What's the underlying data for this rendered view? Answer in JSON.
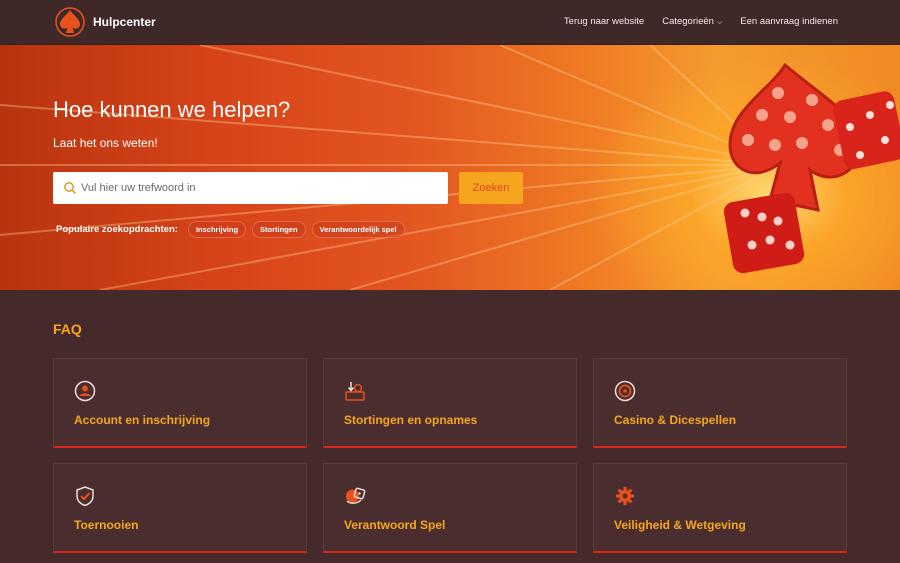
{
  "header": {
    "brand": "Hulpcenter",
    "nav": [
      {
        "label": "Terug naar website"
      },
      {
        "label": "Categorieën"
      },
      {
        "label": "Een aanvraag indienen"
      }
    ]
  },
  "hero": {
    "title": "Hoe kunnen we helpen?",
    "subtitle": "Laat het ons weten!",
    "search": {
      "placeholder": "Vul hier uw trefwoord in",
      "value": "",
      "button_label": "Zoeken"
    },
    "popular_label": "Populaire zoekopdrachten:",
    "popular": [
      "Inschrijving",
      "Stortingen",
      "Verantwoordelijk spel"
    ]
  },
  "faq": {
    "title": "FAQ",
    "cards": [
      {
        "label": "Account en inschrijving",
        "icon": "user-circle-icon"
      },
      {
        "label": "Stortingen en opnames",
        "icon": "deposit-icon"
      },
      {
        "label": "Casino & Dicespellen",
        "icon": "casino-chip-icon"
      },
      {
        "label": "Toernooien",
        "icon": "shield-check-icon"
      },
      {
        "label": "Verantwoord Spel",
        "icon": "dice-hand-icon"
      },
      {
        "label": "Veiligheid & Wetgeving",
        "icon": "gear-icon"
      }
    ]
  },
  "colors": {
    "accent": "#f5a51e",
    "card_border": "#d8261c",
    "background": "#452a2b"
  }
}
